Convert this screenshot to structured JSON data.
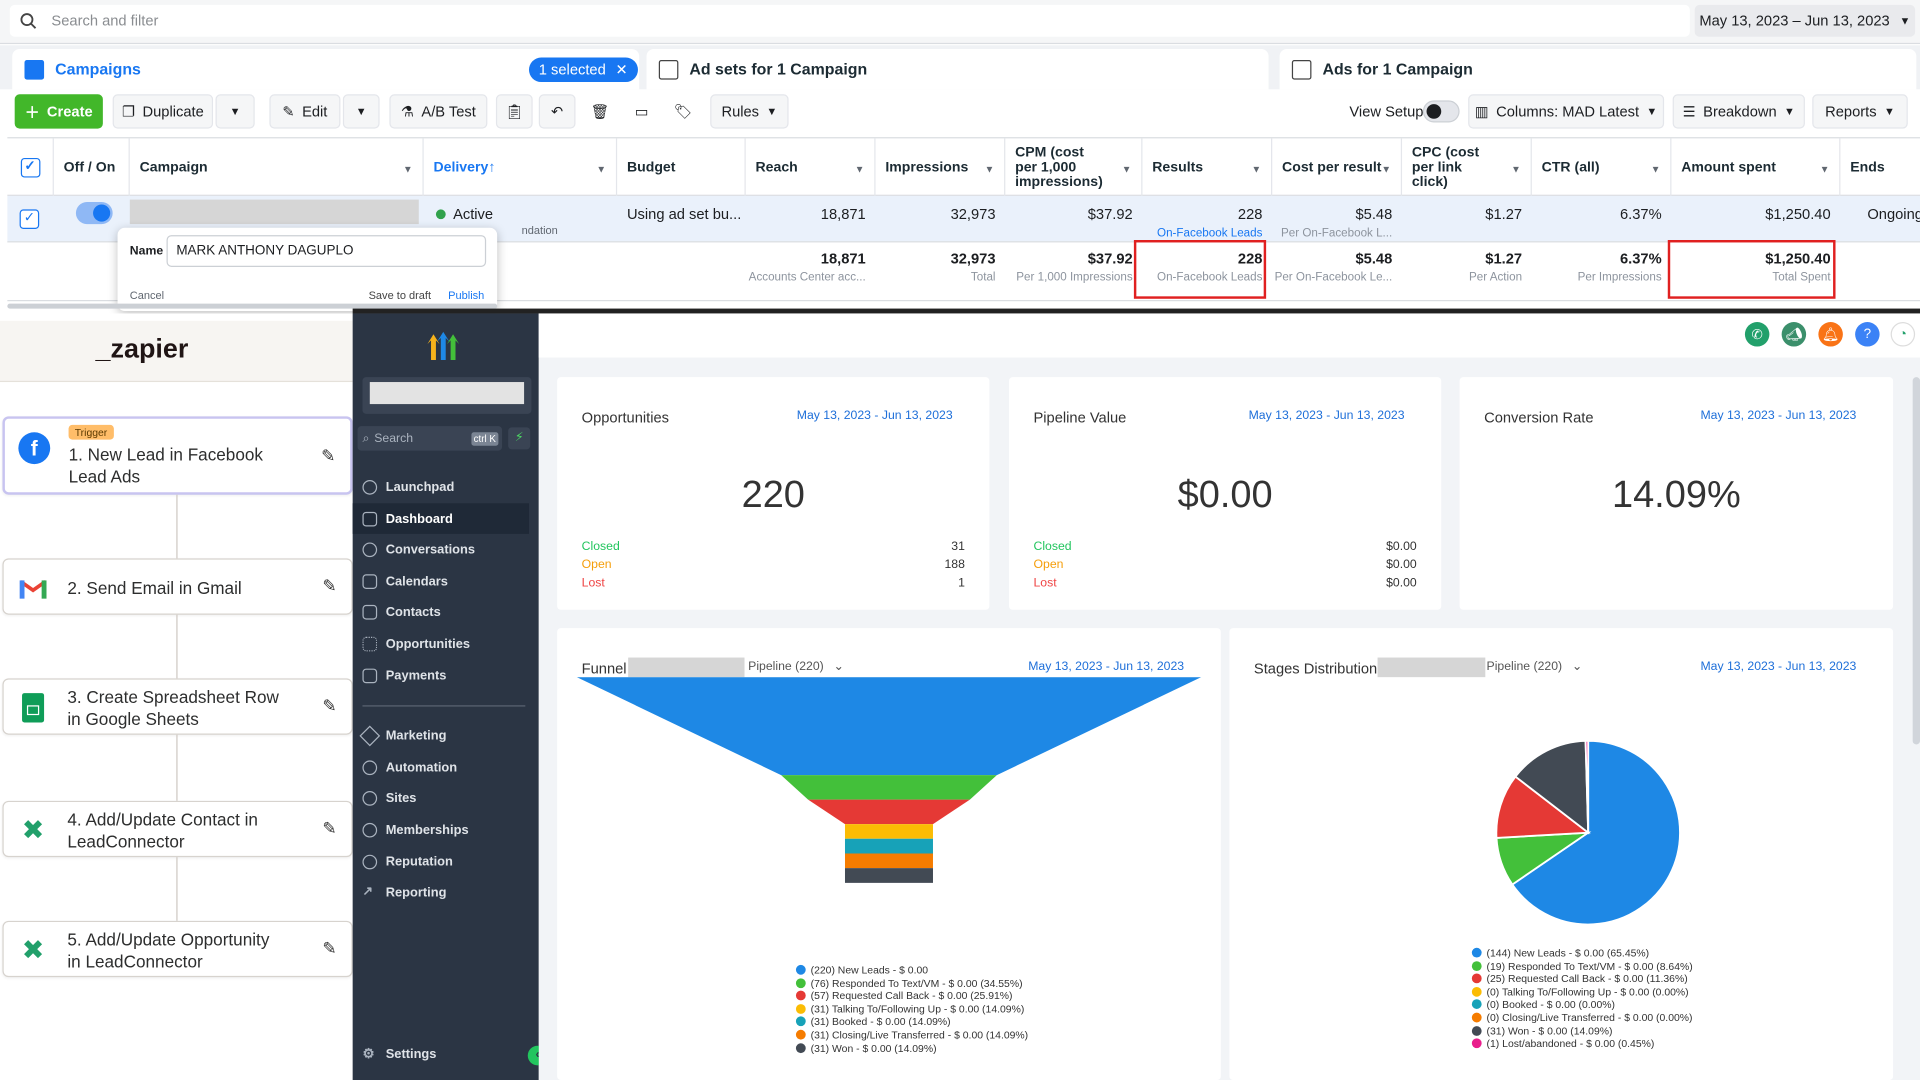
{
  "facebook": {
    "search_placeholder": "Search and filter",
    "date_range": "May 13, 2023 – Jun 13, 2023",
    "tabs": {
      "campaigns": "Campaigns",
      "selected": "1 selected",
      "adsets": "Ad sets for 1 Campaign",
      "ads": "Ads for 1 Campaign"
    },
    "toolbar": {
      "create": "Create",
      "duplicate": "Duplicate",
      "edit": "Edit",
      "ab_test": "A/B Test",
      "rules": "Rules",
      "view_setup": "View Setup",
      "columns": "Columns: MAD Latest",
      "breakdown": "Breakdown",
      "reports": "Reports"
    },
    "headers": [
      "Off / On",
      "Campaign",
      "Delivery",
      "Budget",
      "Reach",
      "Impressions",
      "CPM (cost per 1,000 impressions)",
      "Results",
      "Cost per result",
      "CPC (cost per link click)",
      "CTR (all)",
      "Amount spent",
      "Ends"
    ],
    "row": {
      "delivery": "Active",
      "delivery_sub": "ndation",
      "budget": "Using ad set bu...",
      "reach": "18,871",
      "impressions": "32,973",
      "cpm": "$37.92",
      "results": "228",
      "results_sub": "On-Facebook Leads",
      "cost_per_result": "$5.48",
      "cost_per_result_sub": "Per On-Facebook L...",
      "cpc": "$1.27",
      "ctr": "6.37%",
      "amount": "$1,250.40",
      "ends": "Ongoing"
    },
    "totals": {
      "reach": "18,871",
      "reach_sub": "Accounts Center acc...",
      "impressions": "32,973",
      "impressions_sub": "Total",
      "cpm": "$37.92",
      "cpm_sub": "Per 1,000 Impressions",
      "results": "228",
      "results_sub": "On-Facebook Leads",
      "cost_per_result": "$5.48",
      "cost_per_result_sub": "Per On-Facebook Le...",
      "cpc": "$1.27",
      "cpc_sub": "Per Action",
      "ctr": "6.37%",
      "ctr_sub": "Per Impressions",
      "amount": "$1,250.40",
      "amount_sub": "Total Spent"
    },
    "popup": {
      "name_label": "Name",
      "name_value": "MARK ANTHONY DAGUPLO",
      "cancel": "Cancel",
      "save_draft": "Save to draft",
      "publish": "Publish"
    }
  },
  "zapier": {
    "logo": "_zapier",
    "trigger_badge": "Trigger",
    "steps": [
      {
        "line1": "1. New Lead in Facebook",
        "line2": "Lead Ads"
      },
      {
        "line1": "2. Send Email in Gmail",
        "line2": ""
      },
      {
        "line1": "3. Create Spreadsheet Row",
        "line2": "in Google Sheets"
      },
      {
        "line1": "4. Add/Update Contact in",
        "line2": "LeadConnector"
      },
      {
        "line1": "5. Add/Update Opportunity",
        "line2": "in LeadConnector"
      }
    ]
  },
  "sidebar": {
    "search_placeholder": "Search",
    "search_shortcut": "ctrl K",
    "items": [
      "Launchpad",
      "Dashboard",
      "Conversations",
      "Calendars",
      "Contacts",
      "Opportunities",
      "Payments",
      "Marketing",
      "Automation",
      "Sites",
      "Memberships",
      "Reputation",
      "Reporting"
    ],
    "settings": "Settings"
  },
  "dashboard": {
    "date": "May 13, 2023 - Jun 13, 2023",
    "opportunities": {
      "title": "Opportunities",
      "value": "220",
      "closed_label": "Closed",
      "closed": "31",
      "open_label": "Open",
      "open": "188",
      "lost_label": "Lost",
      "lost": "1"
    },
    "pipeline": {
      "title": "Pipeline Value",
      "value": "$0.00",
      "closed_label": "Closed",
      "closed": "$0.00",
      "open_label": "Open",
      "open": "$0.00",
      "lost_label": "Lost",
      "lost": "$0.00"
    },
    "conversion": {
      "title": "Conversion Rate",
      "value": "14.09%"
    },
    "funnel": {
      "title": "Funnel",
      "pipeline": "Pipeline (220)"
    },
    "stages": {
      "title": "Stages Distribution",
      "pipeline": "Pipeline (220)"
    }
  },
  "chart_data": [
    {
      "type": "funnel",
      "categories": [
        "New Leads",
        "Responded To Text/VM",
        "Requested Call Back",
        "Talking To/Following Up",
        "Booked",
        "Closing/Live Transferred",
        "Won"
      ],
      "values": [
        220,
        76,
        57,
        31,
        31,
        31,
        31
      ],
      "legend": [
        "(220) New Leads - $ 0.00",
        "(76) Responded To Text/VM - $ 0.00 (34.55%)",
        "(57) Requested Call Back - $ 0.00 (25.91%)",
        "(31) Talking To/Following Up - $ 0.00 (14.09%)",
        "(31) Booked - $ 0.00 (14.09%)",
        "(31) Closing/Live Transferred - $ 0.00 (14.09%)",
        "(31) Won - $ 0.00 (14.09%)"
      ],
      "colors": [
        "#1e88e5",
        "#43c03a",
        "#e53935",
        "#fbbc04",
        "#17a2b8",
        "#f57c00",
        "#424a54"
      ]
    },
    {
      "type": "pie",
      "categories": [
        "New Leads",
        "Responded To Text/VM",
        "Requested Call Back",
        "Talking To/Following Up",
        "Booked",
        "Closing/Live Transferred",
        "Won",
        "Lost/abandoned"
      ],
      "values": [
        144,
        19,
        25,
        0,
        0,
        0,
        31,
        1
      ],
      "legend": [
        "(144) New Leads - $ 0.00 (65.45%)",
        "(19) Responded To Text/VM - $ 0.00 (8.64%)",
        "(25) Requested Call Back - $ 0.00 (11.36%)",
        "(0) Talking To/Following Up - $ 0.00 (0.00%)",
        "(0) Booked - $ 0.00 (0.00%)",
        "(0) Closing/Live Transferred - $ 0.00 (0.00%)",
        "(31) Won - $ 0.00 (14.09%)",
        "(1) Lost/abandoned - $ 0.00 (0.45%)"
      ],
      "colors": [
        "#1e88e5",
        "#43c03a",
        "#e53935",
        "#fbbc04",
        "#17a2b8",
        "#f57c00",
        "#424a54",
        "#e91e8c"
      ]
    }
  ]
}
